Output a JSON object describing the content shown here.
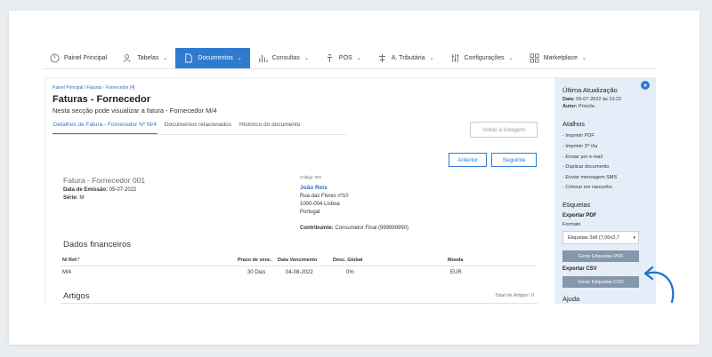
{
  "nav": [
    {
      "label": "Painel Principal",
      "icon": "dashboard-icon",
      "chevron": false,
      "active": false
    },
    {
      "label": "Tabelas",
      "icon": "users-icon",
      "chevron": true,
      "active": false
    },
    {
      "label": "Documentos",
      "icon": "document-icon",
      "chevron": true,
      "active": true
    },
    {
      "label": "Consultas",
      "icon": "bar-chart-icon",
      "chevron": true,
      "active": false
    },
    {
      "label": "POS",
      "icon": "pos-icon",
      "chevron": true,
      "active": false
    },
    {
      "label": "A. Tributária",
      "icon": "tax-icon",
      "chevron": true,
      "active": false
    },
    {
      "label": "Configurações",
      "icon": "sliders-icon",
      "chevron": true,
      "active": false
    },
    {
      "label": "Marketplace",
      "icon": "grid-icon",
      "chevron": true,
      "active": false
    }
  ],
  "breadcrumb": "Painel Principal  /  Faturas - Fornecedor [4]",
  "page": {
    "title": "Faturas - Fornecedor",
    "subtitle": "Nesta secção pode visualizar a fatura - Fornecedor M/4",
    "tabs": [
      "Detalhes de Fatura - Fornecedor Nº M/4",
      "Documentos relacionados",
      "Histórico do documento"
    ],
    "back_label": "Voltar à listagem",
    "prev_label": "Anterior",
    "next_label": "Seguinte"
  },
  "document": {
    "name": "Fatura - Fornecedor 001",
    "issue_label": "Data de Emissão:",
    "issue_value": "05-07-2022",
    "series_label": "Série:",
    "series_value": "M"
  },
  "client": {
    "code": "Código: 001",
    "name": "João Reis",
    "address1": "Rua das Flores nº10",
    "address2": "1000-004 Lisboa",
    "country": "Portugal",
    "contrib_label": "Contribuinte:",
    "contrib_value": "Consumidor Final (999999990)"
  },
  "financial": {
    "heading": "Dados financeiros",
    "headers": [
      "N/ Ref.ª",
      "Prazo de venc.",
      "Data Vencimento",
      "Desc. Global",
      "Moeda"
    ],
    "row": [
      "M/4",
      "30 Dias",
      "04-08-2022",
      "0%",
      "EUR"
    ]
  },
  "articles": {
    "heading": "Artigos",
    "total_label": "Total de Artigos: 0"
  },
  "sidebar": {
    "update_title": "Última Atualização",
    "date_label": "Data:",
    "date_value": "05-07-2022 às 10:22",
    "author_label": "Autor:",
    "author_value": "Priscila",
    "shortcuts_title": "Atalhos",
    "shortcuts": [
      "- Imprimir PDF",
      "- Imprimir 2ª Via",
      "- Enviar por e-mail",
      "- Duplicar documento",
      "- Enviar mensagem SMS",
      "- Colocar em rascunho"
    ],
    "labels_title": "Etiquetas",
    "export_pdf": "Exportar PDF",
    "format_label": "Formato",
    "format_value": "Etiquetas 3x8 (7,00x3,7",
    "gen_pdf": "Gerar Etiquetas PDF",
    "export_csv": "Exportar CSV",
    "gen_csv": "Gerar Etiquetas CSV",
    "help_title": "Ajuda"
  },
  "colors": {
    "accent": "#2f7ccf",
    "sidebar_bg": "#e5eef8",
    "sidebar_button": "#8597ab"
  }
}
